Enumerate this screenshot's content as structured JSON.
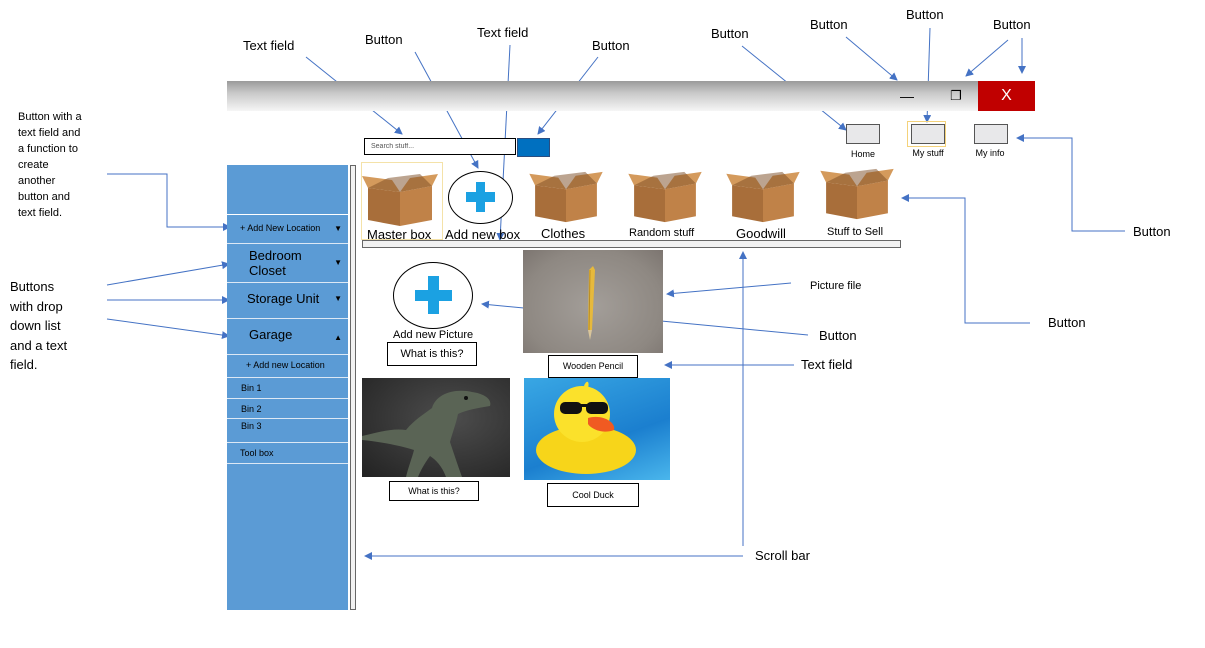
{
  "annotations": {
    "text_field_1": "Text field",
    "button_1": "Button",
    "text_field_2": "Text field",
    "button_2": "Button",
    "button_3": "Button",
    "button_4": "Button",
    "button_5": "Button",
    "button_6": "Button",
    "sidebar_add_note": [
      "Button with a",
      "text field and",
      "a function to",
      "create",
      "another",
      "button and",
      "text field."
    ],
    "sidebar_buttons_note": [
      "Buttons",
      "with drop",
      "down list",
      "and a text",
      "field."
    ],
    "button_right_1": "Button",
    "button_right_2": "Button",
    "picture_file": "Picture file",
    "button_picture": "Button",
    "text_field_picture": "Text field",
    "scroll_bar": "Scroll bar"
  },
  "window": {
    "minimize": "—",
    "restore": "❐",
    "close": "X"
  },
  "search": {
    "placeholder": "Search stuff..."
  },
  "nav": {
    "home": "Home",
    "my_stuff": "My stuff",
    "my_info": "My info"
  },
  "sidebar": {
    "add_new_location": "+ Add New Location",
    "bedroom_closet": [
      "Bedroom",
      "Closet"
    ],
    "storage_unit": "Storage Unit",
    "garage": "Garage",
    "add_new_location_sub": "+ Add new Location",
    "bin1": "Bin 1",
    "bin2": "Bin 2",
    "bin3": "Bin 3",
    "tool_box": "Tool box",
    "arrow_down": "▼",
    "arrow_up": "▲"
  },
  "boxes": {
    "master_box": "Master box",
    "add_new_box": "Add new box",
    "clothes": "Clothes",
    "random_stuff": "Random stuff",
    "goodwill": "Goodwill",
    "stuff_to_sell": "Stuff to Sell"
  },
  "pictures": {
    "add_new_picture": "Add new Picture",
    "what_is_this_1": "What is this?",
    "wooden_pencil": "Wooden Pencil",
    "what_is_this_2": "What is this?",
    "cool_duck": "Cool Duck"
  },
  "colors": {
    "sidebar": "#5b9bd5",
    "close_button": "#c00000",
    "search_button": "#0070c0",
    "plus": "#1ba1e2",
    "arrow": "#4472c4"
  }
}
